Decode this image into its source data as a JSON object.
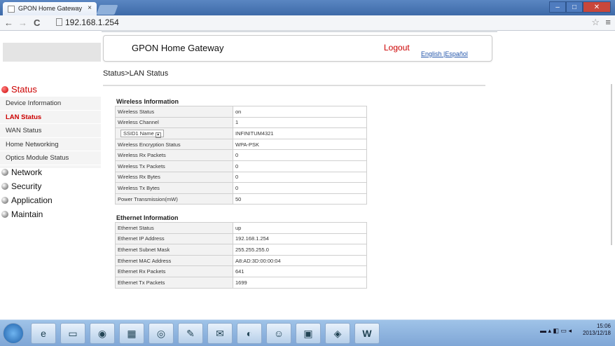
{
  "browser": {
    "tab_title": "GPON Home Gateway",
    "tab_close": "×",
    "url": "192.168.1.254",
    "back": "←",
    "forward": "→",
    "reload": "C"
  },
  "header": {
    "brand": "GPON Home Gateway",
    "logout": "Logout",
    "language": "English |Español"
  },
  "breadcrumb": "Status>LAN Status",
  "sidebar": {
    "status_label": "Status",
    "items": [
      "Device Information",
      "LAN Status",
      "WAN Status",
      "Home Networking",
      "Optics Module Status"
    ],
    "active_item": "LAN Status",
    "sections": [
      "Network",
      "Security",
      "Application",
      "Maintain"
    ]
  },
  "wireless": {
    "title": "Wireless Information",
    "rows": [
      {
        "label": "Wireless Status",
        "value": "on"
      },
      {
        "label": "Wireless Channel",
        "value": "1"
      },
      {
        "label": "SSID1 Name",
        "value": "INFINITUM4321"
      },
      {
        "label": "Wireless Encryption Status",
        "value": "WPA-PSK"
      },
      {
        "label": "Wireless Rx Packets",
        "value": "0"
      },
      {
        "label": "Wireless Tx Packets",
        "value": "0"
      },
      {
        "label": "Wireless Rx Bytes",
        "value": "0"
      },
      {
        "label": "Wireless Tx Bytes",
        "value": "0"
      },
      {
        "label": "Power Transmission(mW)",
        "value": "50"
      }
    ]
  },
  "ethernet": {
    "title": "Ethernet Information",
    "rows": [
      {
        "label": "Ethernet Status",
        "value": "up"
      },
      {
        "label": "Ethernet IP Address",
        "value": "192.168.1.254"
      },
      {
        "label": "Ethernet Subnet Mask",
        "value": "255.255.255.0"
      },
      {
        "label": "Ethernet MAC Address",
        "value": "A8:AD:3D:00:00:04"
      },
      {
        "label": "Ethernet Rx Packets",
        "value": "641"
      },
      {
        "label": "Ethernet Tx Packets",
        "value": "1699"
      }
    ]
  },
  "taskbar": {
    "time": "15:06",
    "date": "2013/12/18"
  }
}
